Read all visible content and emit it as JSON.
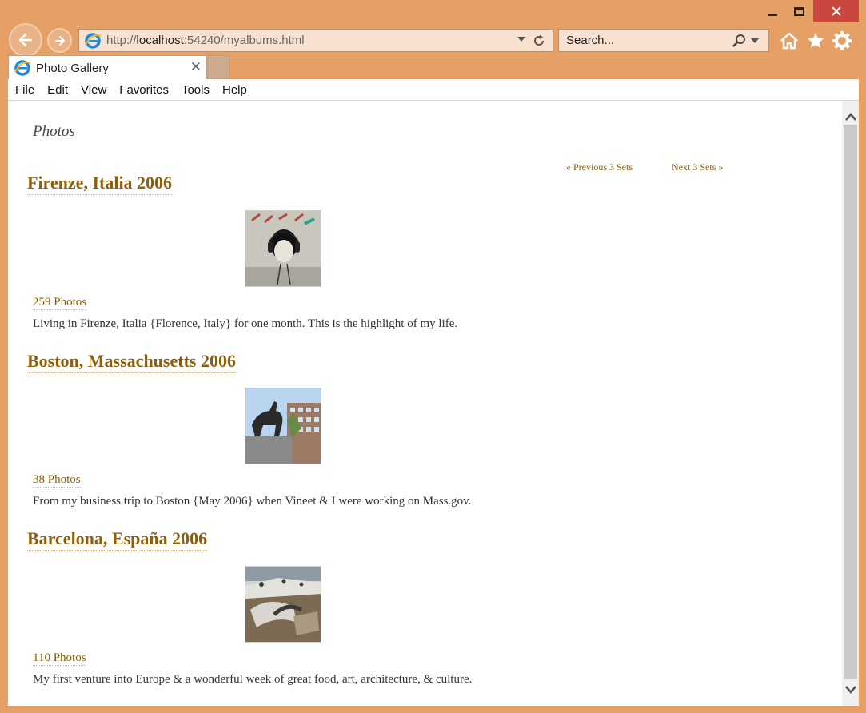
{
  "browser": {
    "address": {
      "prefix": "http://",
      "host": "localhost",
      "rest": ":54240/myalbums.html"
    },
    "search_placeholder": "Search...",
    "tab_title": "Photo Gallery",
    "menu": [
      "File",
      "Edit",
      "View",
      "Favorites",
      "Tools",
      "Help"
    ],
    "colors": {
      "frame": "#e6a066",
      "close": "#c9473e"
    }
  },
  "page": {
    "heading": "Photos",
    "pager": {
      "previous": "« Previous 3 Sets",
      "next": "Next 3 Sets »"
    },
    "albums": [
      {
        "title": "Firenze, Italia 2006",
        "count": "259 Photos",
        "description": "Living in Firenze, Italia {Florence, Italy} for one month. This is the highlight of my life."
      },
      {
        "title": "Boston, Massachusetts 2006",
        "count": "38 Photos",
        "description": "From my business trip to Boston {May 2006} when Vineet & I were working on Mass.gov."
      },
      {
        "title": "Barcelona, España 2006",
        "count": "110 Photos",
        "description": "My first venture into Europe & a wonderful week of great food, art, architecture, & culture."
      }
    ],
    "link_color": "#8c5f08"
  }
}
